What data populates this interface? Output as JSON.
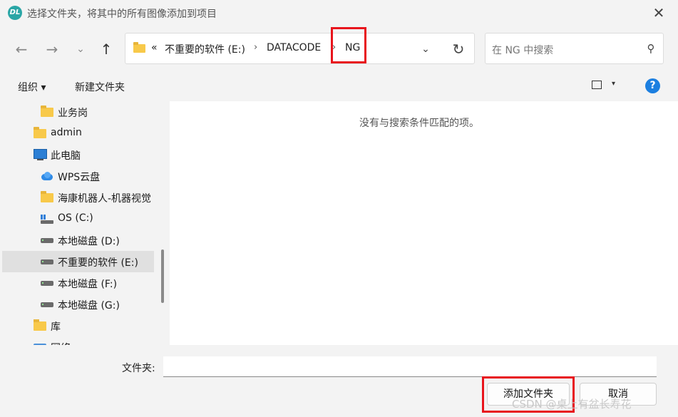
{
  "title": "选择文件夹，将其中的所有图像添加到项目",
  "logo_text": "DL",
  "nav": {
    "back_icon": "←",
    "forward_icon": "→",
    "recent_icon": "⌄",
    "up_icon": "↑",
    "refresh_icon": "↻",
    "dropdown_icon": "⌄"
  },
  "breadcrumb": {
    "overflow": "«",
    "items": [
      "不重要的软件 (E:)",
      "DATACODE",
      "NG"
    ],
    "separator": "›"
  },
  "search": {
    "placeholder": "在 NG 中搜索",
    "icon": "⚲"
  },
  "toolbar": {
    "organize": "组织 ▾",
    "new_folder": "新建文件夹",
    "view_drop": "▾",
    "help": "?"
  },
  "sidebar": {
    "items": [
      {
        "label": "业务岗"
      },
      {
        "label": "admin"
      },
      {
        "label": "此电脑"
      },
      {
        "label": "WPS云盘"
      },
      {
        "label": "海康机器人-机器视觉"
      },
      {
        "label": "OS (C:)"
      },
      {
        "label": "本地磁盘 (D:)"
      },
      {
        "label": "不重要的软件 (E:)"
      },
      {
        "label": "本地磁盘 (F:)"
      },
      {
        "label": "本地磁盘 (G:)"
      },
      {
        "label": "库"
      },
      {
        "label": "网络"
      }
    ]
  },
  "content": {
    "empty_message": "没有与搜索条件匹配的项。"
  },
  "footer": {
    "folder_label": "文件夹:",
    "folder_value": "",
    "add_button": "添加文件夹",
    "cancel_button": "取消"
  },
  "watermark": "CSDN @桌上有盆长寿花",
  "colors": {
    "highlight": "#e8141c",
    "accent": "#1c7fe0",
    "folder": "#f8c94a"
  }
}
